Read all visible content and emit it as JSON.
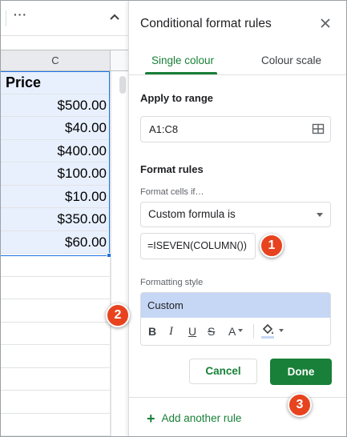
{
  "sheet": {
    "toolbar_more": "···",
    "column_letter": "C",
    "rows": [
      "Price",
      "$500.00",
      "$40.00",
      "$400.00",
      "$100.00",
      "$10.00",
      "$350.00",
      "$60.00",
      "",
      "",
      "",
      "",
      "",
      "",
      "",
      ""
    ]
  },
  "panel": {
    "title": "Conditional format rules",
    "tabs": [
      {
        "label": "Single colour",
        "active": true
      },
      {
        "label": "Colour scale",
        "active": false
      }
    ],
    "apply_to_range_label": "Apply to range",
    "range_value": "A1:C8",
    "format_rules_label": "Format rules",
    "format_cells_if_label": "Format cells if…",
    "condition_value": "Custom formula is",
    "formula_value": "=ISEVEN(COLUMN())",
    "formatting_style_label": "Formatting style",
    "style_preview_label": "Custom",
    "style_tools": {
      "bold": "B",
      "italic": "I",
      "underline": "U",
      "strikethrough": "S",
      "text_colour": "A"
    },
    "cancel_label": "Cancel",
    "done_label": "Done",
    "add_rule_label": "Add another rule",
    "add_rule_icon": "+"
  },
  "badges": [
    "1",
    "2",
    "3"
  ],
  "colors": {
    "accent_green": "#188038",
    "selection_blue": "#1a73e8",
    "badge_orange": "#e8431f",
    "style_preview_bg": "#c6d6f5"
  }
}
